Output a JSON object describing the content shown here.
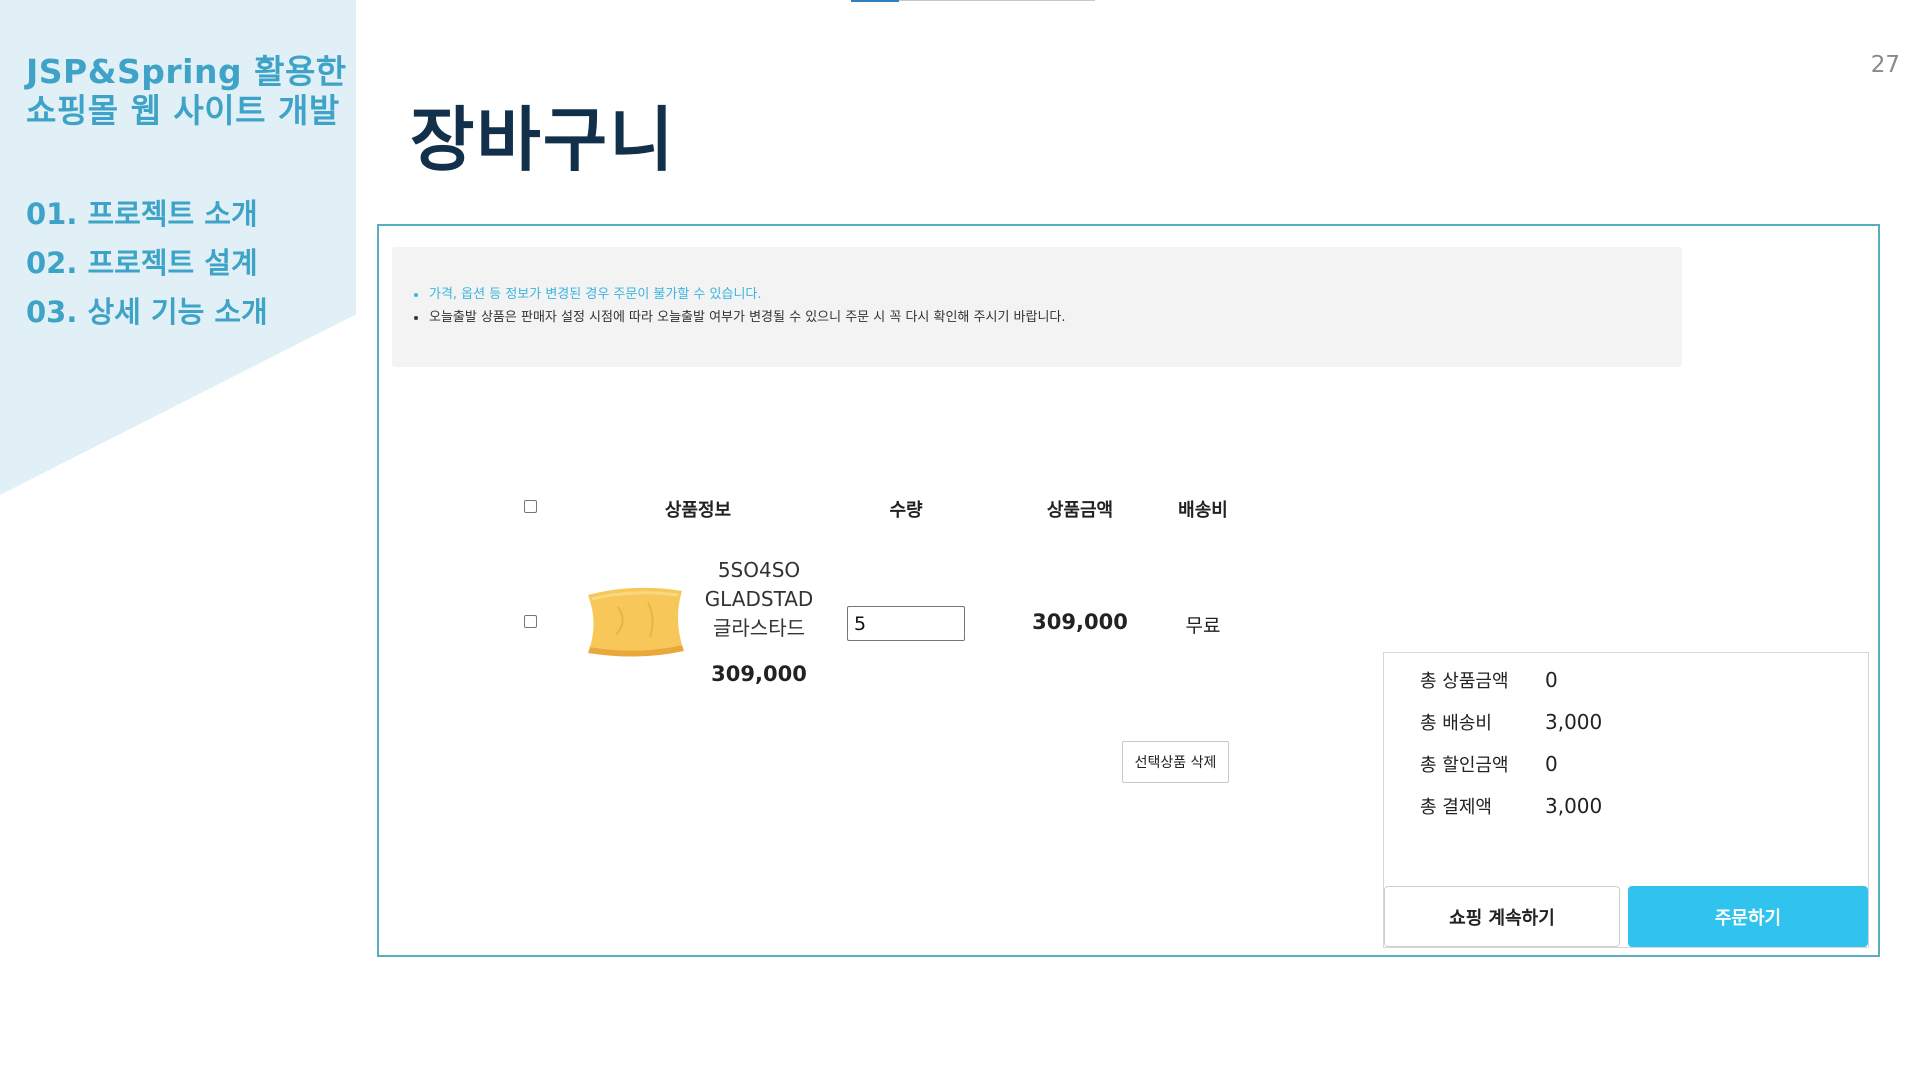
{
  "sidebar": {
    "title_line1": "JSP&Spring 활용한",
    "title_line2": "쇼핑몰 웹 사이트 개발",
    "toc": [
      "01. 프로젝트 소개",
      "02. 프로젝트 설계",
      "03. 상세 기능 소개"
    ]
  },
  "slide": {
    "number": "27",
    "title": "장바구니"
  },
  "cart": {
    "notices": [
      "가격, 옵션 등 정보가 변경된 경우 주문이 불가할 수 있습니다.",
      "오늘출발 상품은 판매자 설정 시점에 따라 오늘출발 여부가 변경될 수 있으니 주문 시 꼭 다시 확인해 주시기 바랍니다."
    ],
    "columns": {
      "product_info": "상품정보",
      "quantity": "수량",
      "amount": "상품금액",
      "shipping": "배송비"
    },
    "item": {
      "name_line1": "5SO4SO",
      "name_line2": "GLADSTAD",
      "name_line3": "글라스타드",
      "price": "309,000",
      "quantity": "5",
      "row_amount": "309,000",
      "shipping": "무료",
      "image_icon": "yellow-pillow-image"
    },
    "delete_selected_label": "선택상품 삭제",
    "summary": {
      "total_product_label": "총 상품금액",
      "total_product_value": "0",
      "total_shipping_label": "총 배송비",
      "total_shipping_value": "3,000",
      "total_discount_label": "총 할인금액",
      "total_discount_value": "0",
      "total_payment_label": "총 결제액",
      "total_payment_value": "3,000"
    },
    "continue_shopping_label": "쇼핑 계속하기",
    "order_label": "주문하기"
  },
  "colors": {
    "accent_teal": "#3ea3c6",
    "panel_bg": "#e1f0f6",
    "title_navy": "#12304a",
    "order_button": "#2fc3ee",
    "notice_blue": "#3ab5e0"
  }
}
